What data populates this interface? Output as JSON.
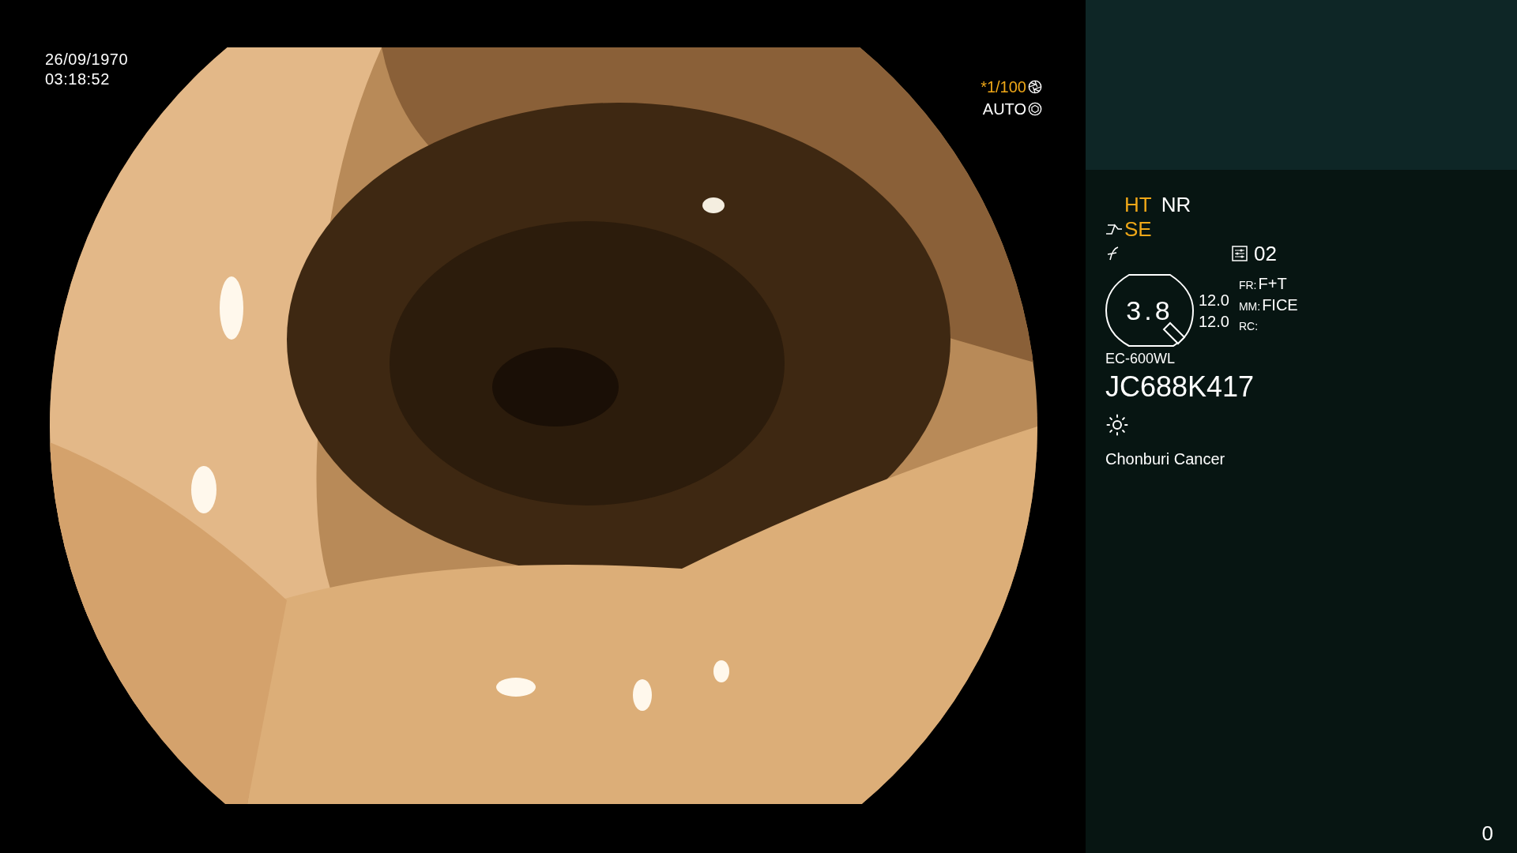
{
  "video": {
    "date": "26/09/1970",
    "time": "03:18:52",
    "shutter": "*1/100",
    "iris": "AUTO"
  },
  "panel": {
    "rows": [
      {
        "kind": "plain",
        "items": [
          {
            "label": "HT",
            "color": "#f0a818"
          },
          {
            "label": "NR",
            "color": "#ffffff"
          }
        ]
      },
      {
        "kind": "curve",
        "items": [
          {
            "label": "SE",
            "color": "#f0a818"
          }
        ]
      }
    ],
    "preset": "02",
    "zoom": "3.8",
    "values": [
      "12.0",
      "12.0"
    ],
    "settings": [
      {
        "key": "FR:",
        "value": "F+T"
      },
      {
        "key": "MM:",
        "value": "FICE"
      },
      {
        "key": "RC:"
      }
    ],
    "scope_model": "EC-600WL",
    "serial": "JC688K417",
    "hospital": "Chonburi Cancer"
  },
  "counter": "0"
}
